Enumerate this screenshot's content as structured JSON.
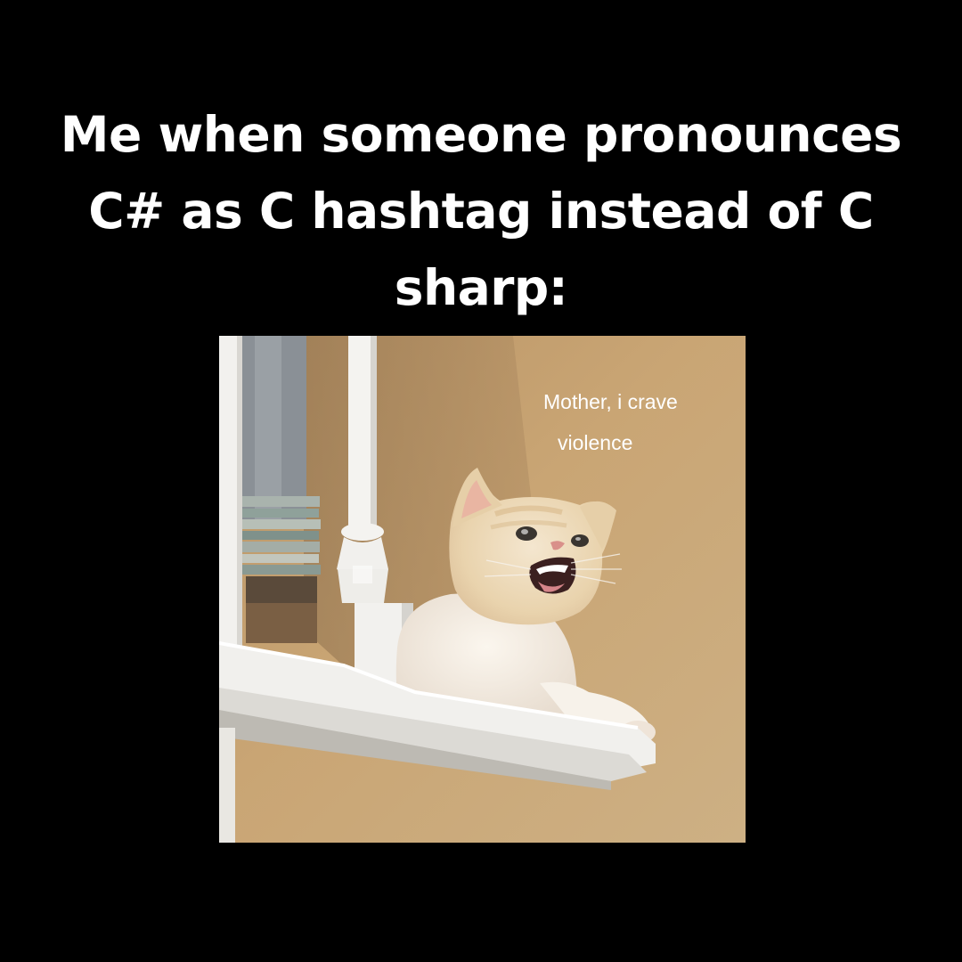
{
  "caption": {
    "line1": "Me when someone pronounces",
    "line2": "C# as C hashtag instead of C",
    "line3": "sharp:"
  },
  "photo": {
    "overlay_line1": "Mother, i crave",
    "overlay_line2": "violence"
  },
  "colors": {
    "background": "#000000",
    "caption_text": "#ffffff",
    "wall": "#c9a574",
    "overlay_text": "#ffffff"
  }
}
